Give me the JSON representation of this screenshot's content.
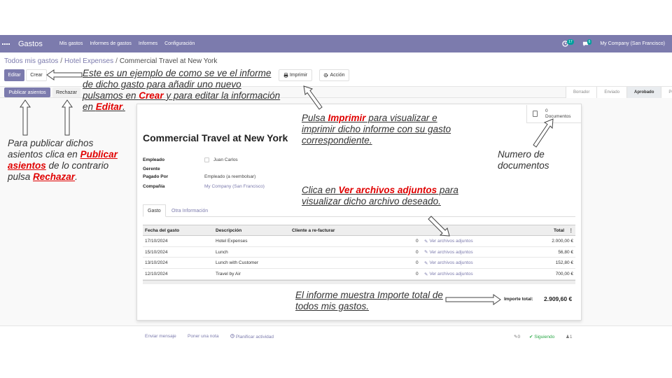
{
  "topbar": {
    "app_name": "Gastos",
    "menu": [
      "Mis gastos",
      "Informes de gastos",
      "Informes",
      "Configuración"
    ],
    "activity_count": "17",
    "message_count": "6",
    "company": "My Company (San Francisco)"
  },
  "breadcrumb": {
    "items": [
      "Todos mis gastos",
      "Hotel Expenses"
    ],
    "current": "Commercial Travel at New York"
  },
  "actions": {
    "edit": "Editar",
    "create": "Crear",
    "print": "Imprimir",
    "action": "Acción"
  },
  "statusbar": {
    "post": "Publicar asientos",
    "reject": "Rechazar",
    "stages": [
      "Borrador",
      "Enviado",
      "Aprobado",
      "Pu"
    ],
    "active_stage": "Aprobado"
  },
  "smart_button": {
    "count": "0",
    "label": "Documentos"
  },
  "sheet": {
    "title": "Commercial Travel at New York",
    "fields": [
      {
        "label": "Empleado",
        "value": "Juan Carlos"
      },
      {
        "label": "Gerente",
        "value": ""
      },
      {
        "label": "Pagado Por",
        "value": "Empleado (a reembolsar)"
      },
      {
        "label": "Compañía",
        "value": "My Company (San Francisco)"
      }
    ],
    "tabs": [
      "Gasto",
      "Otra Información"
    ]
  },
  "table": {
    "headers": [
      "Fecha del gasto",
      "Descripción",
      "Cliente a re-facturar",
      "Total"
    ],
    "rows": [
      {
        "date": "17/10/2024",
        "desc": "Hotel Expenses",
        "qty": "0",
        "attach": "Ver archivos adjuntos",
        "total": "2.000,00 €"
      },
      {
        "date": "15/10/2024",
        "desc": "Lunch",
        "qty": "0",
        "attach": "Ver archivos adjuntos",
        "total": "56,80 €"
      },
      {
        "date": "13/10/2024",
        "desc": "Lunch with Customer",
        "qty": "0",
        "attach": "Ver archivos adjuntos",
        "total": "152,80 €"
      },
      {
        "date": "12/10/2024",
        "desc": "Travel by Air",
        "qty": "0",
        "attach": "Ver archivos adjuntos",
        "total": "700,00 €"
      }
    ]
  },
  "totals": {
    "label": "Importe total:",
    "value": "2.909,60 €"
  },
  "chatter": {
    "send": "Enviar mensaje",
    "note": "Poner una nota",
    "activity": "Planificar actividad",
    "attachments": "0",
    "following": "Siguiendo",
    "followers": "1"
  },
  "annotations": {
    "edit_create": [
      "Este es un ejemplo de como se ve el informe de dicho gasto para añadir uno nuevo pulsamos en ",
      "Crear",
      " y para editar la información en ",
      "Editar",
      "."
    ],
    "publish": [
      "Para publicar dichos asientos clica en ",
      "Publicar asientos",
      " de lo contrario pulsa ",
      "Rechazar",
      "."
    ],
    "print": [
      "Pulsa ",
      "Imprimir",
      " para visualizar e imprimir dicho informe con su gasto correspondiente."
    ],
    "documents": "Numero de documentos",
    "attachments": [
      "Clica en ",
      "Ver archivos adjuntos",
      " para visualizar dicho archivo deseado."
    ],
    "total": "El informe muestra Importe total de todos mis gastos."
  },
  "colors": {
    "brand": "#7c7bad",
    "highlight": "#e00000"
  }
}
